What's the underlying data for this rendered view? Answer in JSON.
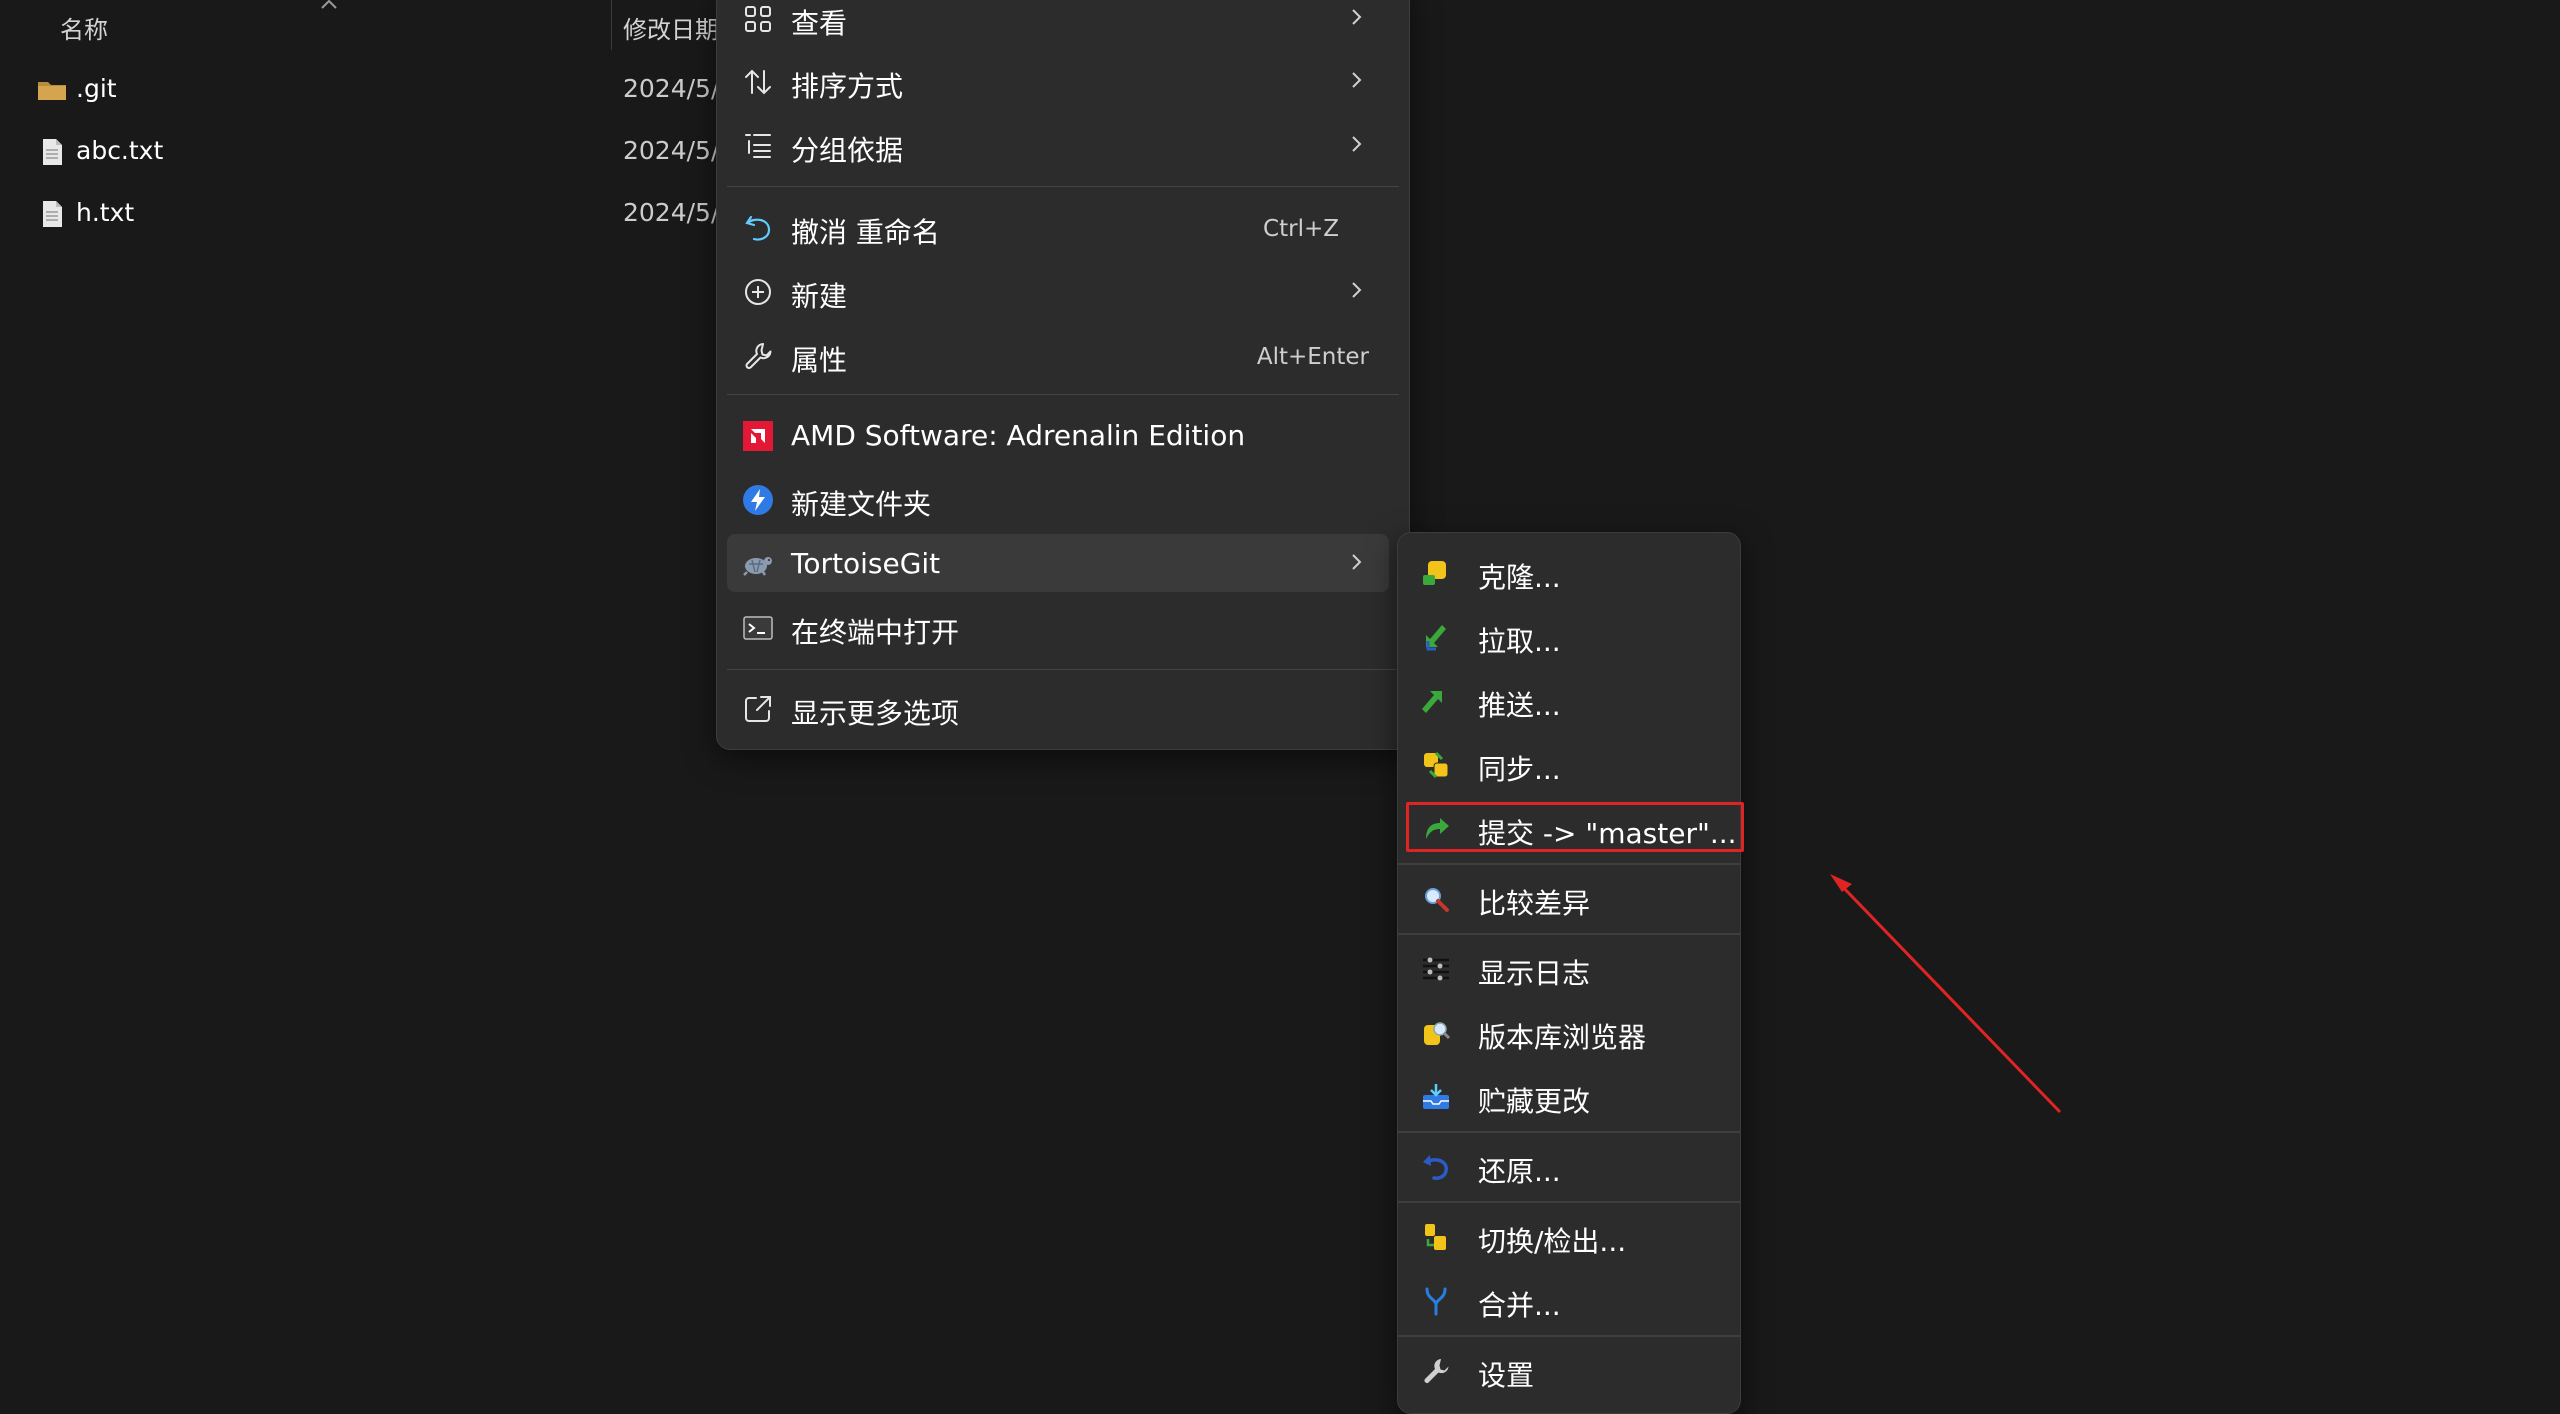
{
  "file_list": {
    "columns": {
      "name": "名称",
      "date": "修改日期"
    },
    "files": [
      {
        "name": ".git",
        "date": "2024/5/",
        "icon": "folder-icon"
      },
      {
        "name": "abc.txt",
        "date": "2024/5/",
        "icon": "text-file-icon"
      },
      {
        "name": "h.txt",
        "date": "2024/5/",
        "icon": "text-file-icon"
      }
    ]
  },
  "context_menu": {
    "items": [
      {
        "label": "查看",
        "icon": "grid-view-icon",
        "submenu": true
      },
      {
        "label": "排序方式",
        "icon": "sort-icon",
        "submenu": true
      },
      {
        "label": "分组依据",
        "icon": "group-list-icon",
        "submenu": true
      },
      {
        "label": "撤消 重命名",
        "icon": "undo-icon",
        "shortcut": "Ctrl+Z"
      },
      {
        "label": "新建",
        "icon": "new-plus-icon",
        "submenu": true
      },
      {
        "label": "属性",
        "icon": "wrench-icon",
        "shortcut": "Alt+Enter"
      },
      {
        "label": "AMD Software: Adrenalin Edition",
        "icon": "amd-logo-icon"
      },
      {
        "label": "新建文件夹",
        "icon": "lightning-app-icon"
      },
      {
        "label": "TortoiseGit",
        "icon": "tortoisegit-icon",
        "submenu": true,
        "active": true
      },
      {
        "label": "在终端中打开",
        "icon": "terminal-icon"
      },
      {
        "label": "显示更多选项",
        "icon": "external-share-icon"
      }
    ]
  },
  "tortoisegit_submenu": {
    "items": [
      {
        "label": "克隆...",
        "icon": "clone-icon"
      },
      {
        "label": "拉取...",
        "icon": "pull-icon"
      },
      {
        "label": "推送...",
        "icon": "push-icon"
      },
      {
        "label": "同步...",
        "icon": "sync-icon"
      },
      {
        "label": "提交 -> \"master\"...",
        "icon": "commit-icon",
        "highlighted": true
      },
      {
        "label": "比较差异",
        "icon": "diff-magnifier-icon"
      },
      {
        "label": "显示日志",
        "icon": "log-icon"
      },
      {
        "label": "版本库浏览器",
        "icon": "repo-browser-icon"
      },
      {
        "label": "贮藏更改",
        "icon": "stash-icon"
      },
      {
        "label": "还原...",
        "icon": "revert-icon"
      },
      {
        "label": "切换/检出...",
        "icon": "switch-checkout-icon"
      },
      {
        "label": "合并...",
        "icon": "merge-icon"
      },
      {
        "label": "设置",
        "icon": "settings-wrench-icon"
      }
    ]
  },
  "annotation": {
    "color": "#e02424"
  },
  "colors": {
    "background": "#191919",
    "menu": "#2c2c2c",
    "accent_blue": "#60cdff"
  }
}
